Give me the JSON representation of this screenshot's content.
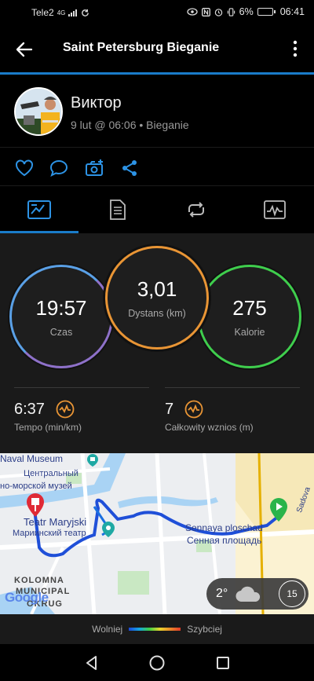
{
  "status": {
    "carrier": "Tele2",
    "network": "4G",
    "battery": "6%",
    "time": "06:41"
  },
  "header": {
    "title": "Saint Petersburg Bieganie",
    "back_icon": "arrow-left-icon",
    "more_icon": "more-vertical-icon"
  },
  "profile": {
    "name": "Виктор",
    "meta": "9 lut @ 06:06 • Bieganie"
  },
  "actions": [
    "heart-icon",
    "comment-icon",
    "add-photo-icon",
    "share-icon"
  ],
  "tabs": [
    "summary-tab",
    "details-tab",
    "laps-tab",
    "charts-tab"
  ],
  "stats": {
    "time": {
      "value": "19:57",
      "label": "Czas"
    },
    "distance": {
      "value": "3,01",
      "label": "Dystans (km)"
    },
    "calories": {
      "value": "275",
      "label": "Kalorie"
    },
    "pace": {
      "value": "6:37",
      "label": "Tempo (min/km)"
    },
    "elevation": {
      "value": "7",
      "label": "Całkowity wznios (m)"
    }
  },
  "map": {
    "labels": {
      "naval_museum": "Naval Museum",
      "central_1": "Центральный",
      "central_2": "но-морской музей",
      "teatr": "Teatr Maryjski",
      "teatr_ru": "Мариинский театр",
      "sennaya": "Sennaya ploschad",
      "sennaya_ru": "Сенная площадь",
      "sadovaya": "Sadova",
      "kolomna_1": "KOLOMNA",
      "kolomna_2": "MUNICIPAL",
      "kolomna_3": "OKRUG",
      "google": "Google"
    },
    "weather": {
      "temperature": "2°",
      "wind": "15"
    }
  },
  "legend": {
    "slower": "Wolniej",
    "faster": "Szybciej"
  },
  "colors": {
    "accent": "#1a7cc9",
    "time_ring": "#5aa0e6",
    "distance_ring": "#e99535",
    "calories_ring": "#3fce4d",
    "wave_icon": "#e99535"
  }
}
